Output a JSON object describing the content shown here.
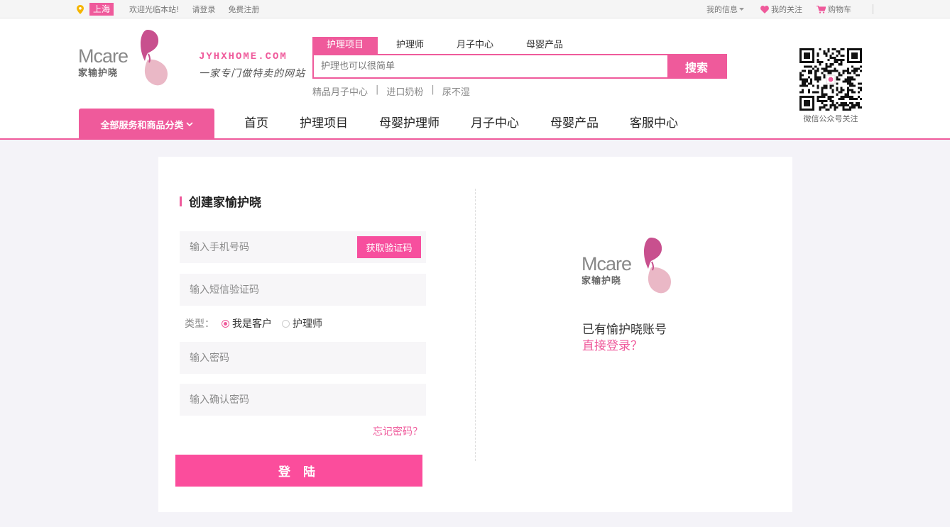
{
  "topbar": {
    "city": "上海",
    "welcome": "欢迎光临本站!",
    "login": "请登录",
    "register": "免费注册",
    "my_info": "我的信息",
    "my_follow": "我的关注",
    "cart": "购物车"
  },
  "brand": {
    "logo_text": "Mcare",
    "logo_cn": "家输护晓",
    "domain": "JYHXHOME.COM",
    "slogan": "一家专门做特卖的网站"
  },
  "search": {
    "tabs": [
      "护理项目",
      "护理师",
      "月子中心",
      "母婴产品"
    ],
    "active_tab": 0,
    "placeholder": "护理也可以很简单",
    "button": "搜索",
    "hotwords": [
      "精品月子中心",
      "进口奶粉",
      "尿不湿"
    ]
  },
  "qr": {
    "label": "微信公众号关注"
  },
  "nav": {
    "category_button": "全部服务和商品分类",
    "items": [
      "首页",
      "护理项目",
      "母婴护理师",
      "月子中心",
      "母婴产品",
      "客服中心"
    ]
  },
  "form": {
    "title": "创建家愉护晓",
    "phone_placeholder": "输入手机号码",
    "get_code": "获取验证码",
    "sms_placeholder": "输入短信验证码",
    "type_label": "类型：",
    "type_options": [
      "我是客户",
      "护理师"
    ],
    "type_selected": 0,
    "password_placeholder": "输入密码",
    "confirm_placeholder": "输入确认密码",
    "forgot": "忘记密码？",
    "submit": "登 陆"
  },
  "aside": {
    "have_account": "已有愉护晓账号",
    "direct_login": "直接登录？"
  },
  "colors": {
    "brand_pink": "#ef5a9b",
    "button_pink": "#fb4d9c",
    "logo_magenta": "#c8508e",
    "logo_blush": "#eab8c6"
  }
}
